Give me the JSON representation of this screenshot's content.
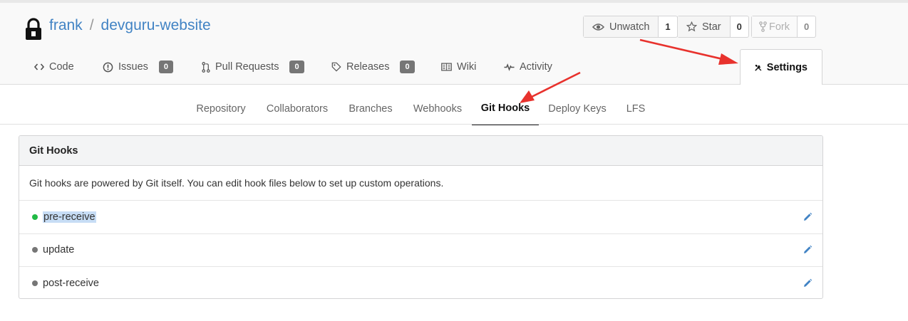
{
  "repo": {
    "owner": "frank",
    "separator": "/",
    "name": "devguru-website"
  },
  "actions": {
    "watch": {
      "label": "Unwatch",
      "count": "1",
      "icon": "eye-icon"
    },
    "star": {
      "label": "Star",
      "count": "0",
      "icon": "star-icon"
    },
    "fork": {
      "label": "Fork",
      "count": "0",
      "icon": "fork-icon"
    }
  },
  "repo_nav": {
    "code": {
      "label": "Code",
      "icon": "code-icon"
    },
    "issues": {
      "label": "Issues",
      "badge": "0",
      "icon": "issue-icon"
    },
    "pulls": {
      "label": "Pull Requests",
      "badge": "0",
      "icon": "pull-request-icon"
    },
    "releases": {
      "label": "Releases",
      "badge": "0",
      "icon": "tag-icon"
    },
    "wiki": {
      "label": "Wiki",
      "icon": "book-icon"
    },
    "activity": {
      "label": "Activity",
      "icon": "pulse-icon"
    },
    "settings": {
      "label": "Settings",
      "icon": "tools-icon"
    }
  },
  "settings_nav": {
    "items": [
      "Repository",
      "Collaborators",
      "Branches",
      "Webhooks",
      "Git Hooks",
      "Deploy Keys",
      "LFS"
    ],
    "active": "Git Hooks"
  },
  "panel": {
    "title": "Git Hooks",
    "description": "Git hooks are powered by Git itself. You can edit hook files below to set up custom operations.",
    "hooks": [
      {
        "name": "pre-receive",
        "status": "active",
        "status_color": "#21ba45"
      },
      {
        "name": "update",
        "status": "inactive",
        "status_color": "#767676"
      },
      {
        "name": "post-receive",
        "status": "inactive",
        "status_color": "#767676"
      }
    ]
  },
  "colors": {
    "link": "#4183c4",
    "annotation_arrow": "#e8322d",
    "badge": "#767676"
  }
}
